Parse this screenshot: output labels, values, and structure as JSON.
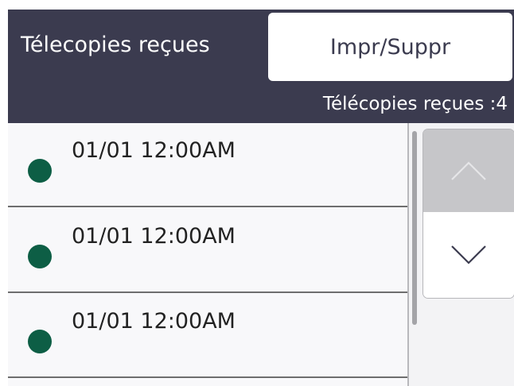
{
  "header": {
    "title": "Télecopies reçues",
    "action_button_label": "Impr/Suppr",
    "count_label": "Télécopies reçues :4"
  },
  "list": {
    "items": [
      {
        "status_icon": "green-dot-icon",
        "timestamp": "01/01 12:00AM"
      },
      {
        "status_icon": "green-dot-icon",
        "timestamp": "01/01 12:00AM"
      },
      {
        "status_icon": "green-dot-icon",
        "timestamp": "01/01 12:00AM"
      }
    ]
  },
  "scroll": {
    "up_icon": "chevron-up-icon",
    "down_icon": "chevron-down-icon"
  },
  "colors": {
    "header_background": "#3b3b4f",
    "status_dot": "#0d5e45",
    "list_background": "#f8f8fa",
    "up_button_background": "#c6c6c9"
  }
}
